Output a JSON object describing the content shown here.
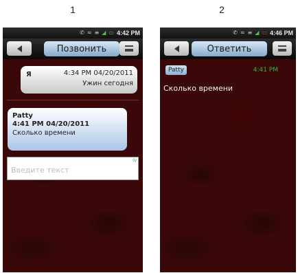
{
  "captions": [
    "1",
    "2"
  ],
  "status_bar": {
    "phone1_time": "4:42 PM",
    "phone2_time": "4:46 PM",
    "icons": [
      "phone-icon",
      "wifi-icon",
      "vibrate-icon",
      "signal-icon",
      "battery-icon"
    ]
  },
  "screen1": {
    "title_button": "Позвонить",
    "messages": [
      {
        "sender": "Я",
        "timestamp": "4:34 PM  04/20/2011",
        "text": "Ужин сегодня"
      },
      {
        "sender": "Patty",
        "timestamp": "4:41 PM  04/20/2011",
        "text": "Сколько времени"
      }
    ],
    "input_placeholder": "Введите текст",
    "char_counter": "0/"
  },
  "screen2": {
    "title_button": "Ответить",
    "sender_chip": "Patty",
    "time": "4:41 PM",
    "message_text": "Сколько времени"
  },
  "colors": {
    "background_wallpaper": "#3a0808",
    "bubble_outgoing": "#c9c9c9",
    "bubble_incoming": "#aac5e8",
    "time_green": "#3bb03b",
    "title_button": "#87a9cc"
  }
}
